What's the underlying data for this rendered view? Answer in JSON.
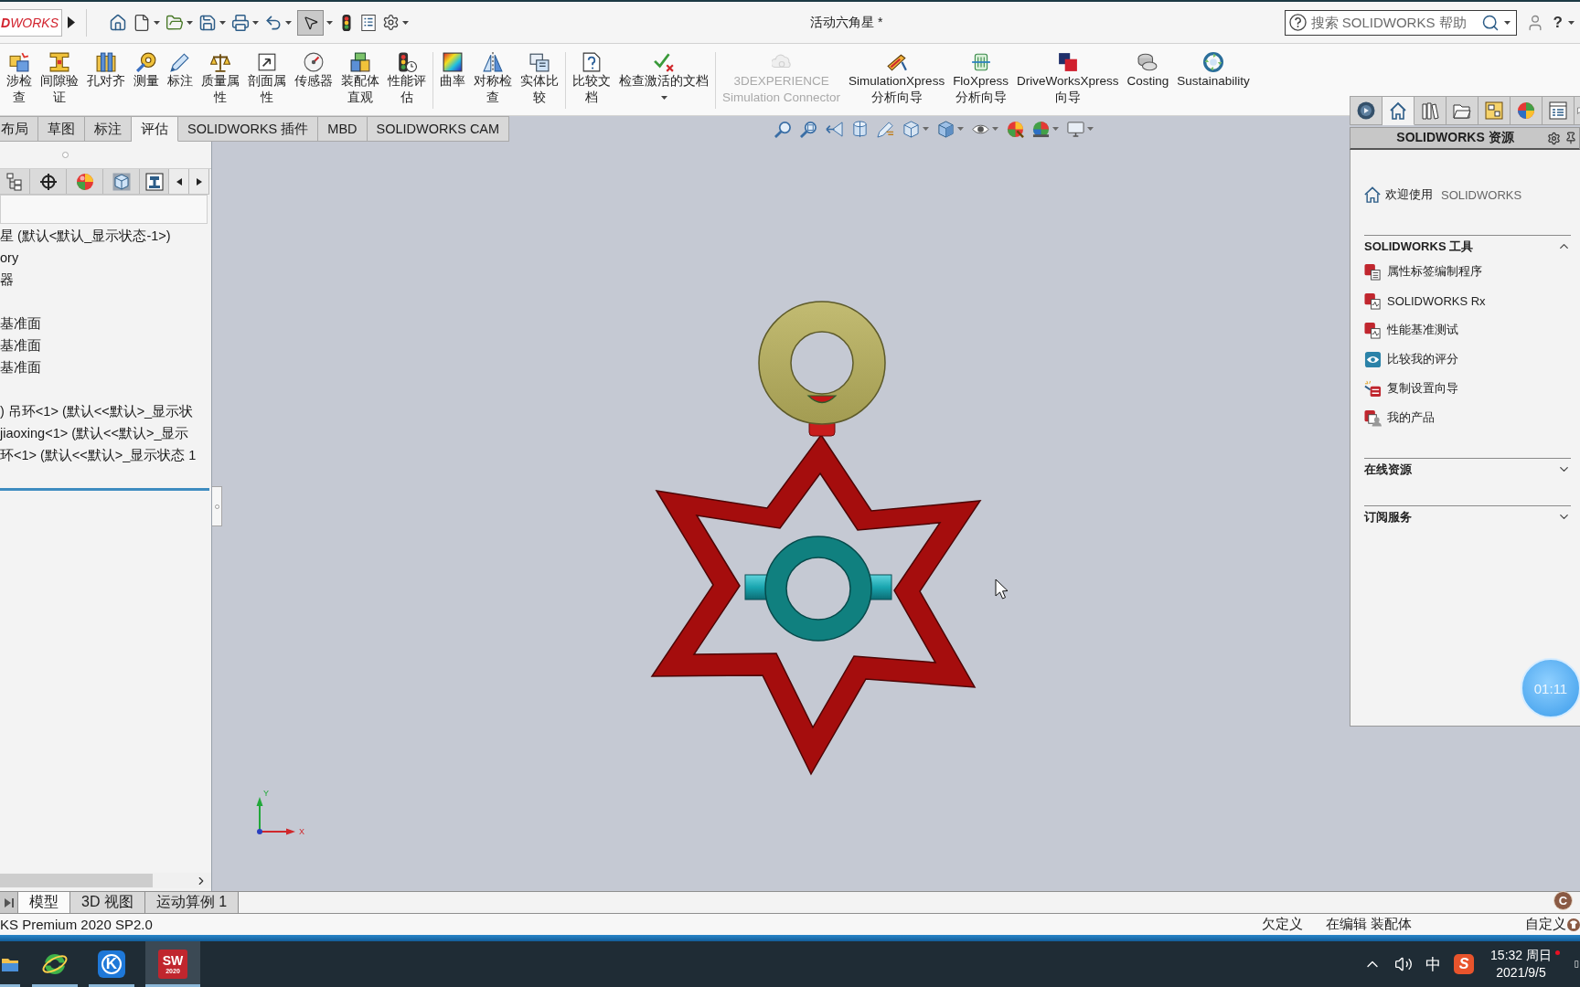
{
  "title_bar": {
    "logo": "**D**WORKS",
    "select_tool_active": true,
    "title": "活动六角星 *",
    "search": {
      "placeholder": "搜索 SOLIDWORKS 帮助"
    },
    "help": "?"
  },
  "command_groups": [
    [
      {
        "lines": [
          "涉检",
          "查"
        ],
        "disabled": false,
        "menu": false
      },
      {
        "lines": [
          "间隙验",
          "证"
        ],
        "disabled": false,
        "menu": false
      },
      {
        "lines": [
          "孔对齐"
        ],
        "disabled": false,
        "menu": false
      },
      {
        "lines": [
          "测量"
        ],
        "disabled": false,
        "menu": false
      },
      {
        "lines": [
          "标注"
        ],
        "disabled": false,
        "menu": false
      },
      {
        "lines": [
          "质量属",
          "性"
        ],
        "disabled": false,
        "menu": false
      },
      {
        "lines": [
          "剖面属",
          "性"
        ],
        "disabled": false,
        "menu": false
      },
      {
        "lines": [
          "传感器"
        ],
        "disabled": false,
        "menu": false
      },
      {
        "lines": [
          "装配体",
          "直观"
        ],
        "disabled": false,
        "menu": false
      },
      {
        "lines": [
          "性能评",
          "估"
        ],
        "disabled": false,
        "menu": false
      }
    ],
    [
      {
        "lines": [
          "曲率"
        ],
        "disabled": false,
        "menu": false
      },
      {
        "lines": [
          "对称检",
          "查"
        ],
        "disabled": false,
        "menu": false
      },
      {
        "lines": [
          "实体比",
          "较"
        ],
        "disabled": false,
        "menu": false
      }
    ],
    [
      {
        "lines": [
          "比较文",
          "档"
        ],
        "disabled": false,
        "menu": false
      },
      {
        "lines": [
          "检查激活的文档"
        ],
        "disabled": false,
        "menu": true
      }
    ],
    [
      {
        "lines": [
          "3DEXPERIENCE",
          "Simulation Connector"
        ],
        "disabled": true,
        "menu": false
      },
      {
        "lines": [
          "SimulationXpress",
          "分析向导"
        ],
        "disabled": false,
        "menu": false
      },
      {
        "lines": [
          "FloXpress",
          "分析向导"
        ],
        "disabled": false,
        "menu": false
      },
      {
        "lines": [
          "DriveWorksXpress",
          "向导"
        ],
        "disabled": false,
        "menu": false
      },
      {
        "lines": [
          "Costing"
        ],
        "disabled": false,
        "menu": false
      },
      {
        "lines": [
          "Sustainability"
        ],
        "disabled": false,
        "menu": false
      }
    ]
  ],
  "tabs": [
    {
      "label": "布局",
      "selected": false
    },
    {
      "label": "草图",
      "selected": false
    },
    {
      "label": "标注",
      "selected": false
    },
    {
      "label": "评估",
      "selected": true
    },
    {
      "label": "SOLIDWORKS 插件",
      "selected": false
    },
    {
      "label": "MBD",
      "selected": false
    },
    {
      "label": "SOLIDWORKS CAM",
      "selected": false
    }
  ],
  "feature_tree": {
    "groups": [
      [
        "星 (默认<默认_显示状态-1>)",
        "ory",
        "器"
      ],
      [
        "基准面",
        "基准面",
        "基准面"
      ],
      [
        ") 吊环<1> (默认<<默认>_显示状",
        "jiaoxing<1> (默认<<默认>_显示",
        "环<1> (默认<<默认>_显示状态 1"
      ]
    ]
  },
  "graphics": {
    "triad": {
      "x_label": "X",
      "y_label": "Y"
    }
  },
  "task_pane": {
    "tabs": [
      {
        "selected": false
      },
      {
        "selected": true
      },
      {
        "selected": false
      },
      {
        "selected": false
      },
      {
        "selected": false
      },
      {
        "selected": false
      },
      {
        "selected": false
      },
      {
        "selected": false
      }
    ],
    "title": "SOLIDWORKS 资源",
    "welcome": {
      "label": "欢迎使用",
      "product": "SOLIDWORKS"
    },
    "sections": [
      {
        "title": "SOLIDWORKS 工具",
        "expanded": true,
        "items": [
          "属性标签编制程序",
          "SOLIDWORKS Rx",
          "性能基准测试",
          "比较我的评分",
          "复制设置向导",
          "我的产品"
        ]
      },
      {
        "title": "在线资源",
        "expanded": false
      },
      {
        "title": "订阅服务",
        "expanded": false
      }
    ]
  },
  "recorder_timer": "01:11",
  "model_tabs": [
    {
      "label": "模型",
      "selected": true
    },
    {
      "label": "3D 视图",
      "selected": false
    },
    {
      "label": "运动算例 1",
      "selected": false
    }
  ],
  "status_bar": {
    "version": "KS Premium 2020 SP2.0",
    "definition": "欠定义",
    "editing": "在编辑 装配体",
    "units": "自定义",
    "badge": "C"
  },
  "taskbar": {
    "apps": [
      {
        "selected": false
      },
      {
        "selected": false
      },
      {
        "selected": false,
        "logo": [
          "K"
        ]
      },
      {
        "selected": true,
        "logo": [
          "SW",
          "2020"
        ]
      }
    ],
    "tray": {
      "ime": "中",
      "ime_logo": "S",
      "time": "15:32 周日",
      "date": "2021/9/5",
      "notification": true
    }
  }
}
